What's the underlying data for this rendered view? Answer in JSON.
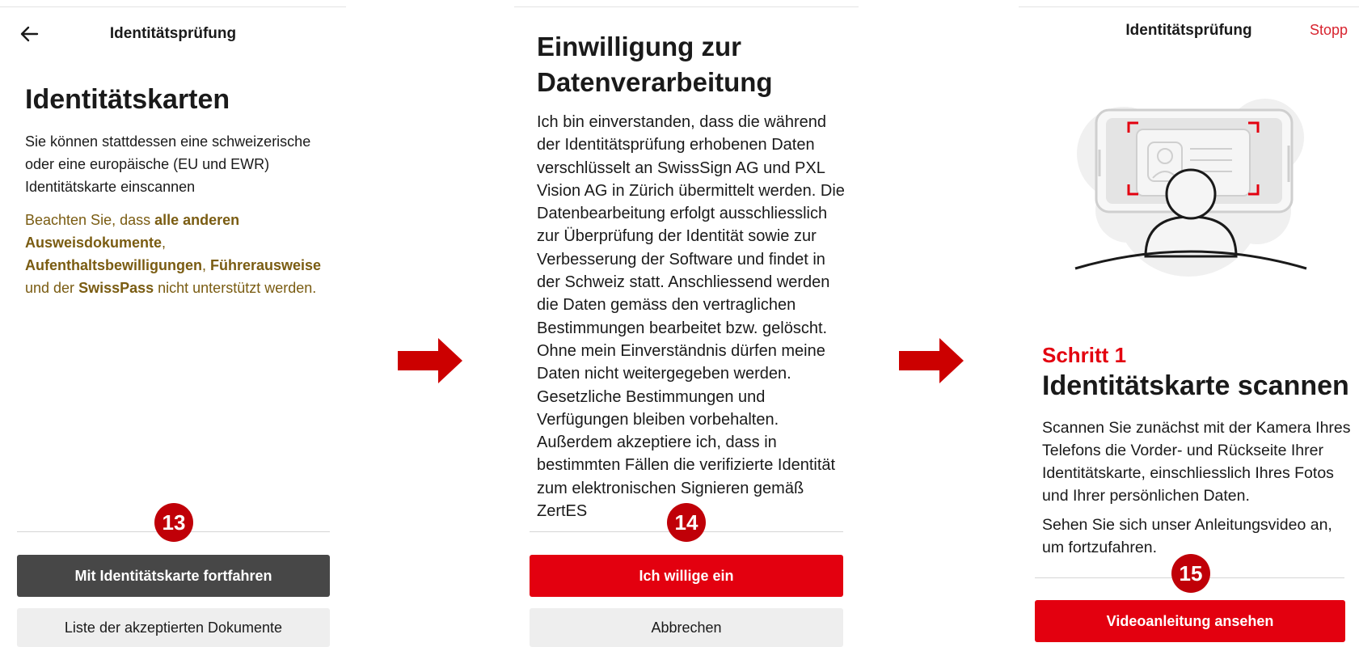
{
  "screen1": {
    "header_title": "Identitätsprüfung",
    "heading": "Identitätskarten",
    "description": "Sie können stattdessen eine schweizerische oder eine europäische (EU und EWR) Identitätskarte einscannen",
    "note": {
      "part1": "Beachten Sie, dass ",
      "bold1": "alle anderen Ausweisdokumente",
      "part2": ", ",
      "bold2": "Aufenthaltsbewilligungen",
      "part3": ", ",
      "bold3": "Führerausweise",
      "part4": " und der ",
      "bold4": "SwissPass",
      "part5": " nicht unterstützt werden."
    },
    "badge": "13",
    "primary_button": "Mit Identitätskarte fortfahren",
    "secondary_button": "Liste der akzeptierten Dokumente"
  },
  "screen2": {
    "heading_line1": "Einwilligung zur",
    "heading_line2": "Datenverarbeitung",
    "consent_text": "Ich bin einverstanden, dass die während der Identitätsprüfung erhobenen Daten verschlüsselt an SwissSign AG und PXL Vision AG in Zürich übermittelt werden. Die Datenbearbeitung erfolgt ausschliesslich zur Überprüfung der Identität sowie zur Verbesserung der Software und findet in der Schweiz statt. Anschliessend werden die Daten gemäss den vertraglichen Bestimmungen bearbeitet bzw. gelöscht. Ohne mein Einverständnis dürfen meine Daten nicht weitergegeben werden. Gesetzliche Bestimmungen und Verfügungen bleiben vorbehalten. Außerdem akzeptiere ich, dass in bestimmten Fällen die verifizierte Identität zum elektronischen Signieren gemäß ZertES",
    "badge": "14",
    "primary_button": "Ich willige ein",
    "secondary_button": "Abbrechen"
  },
  "screen3": {
    "header_title": "Identitätsprüfung",
    "stop_label": "Stopp",
    "step_label": "Schritt 1",
    "heading": "Identitätskarte scannen",
    "description1": "Scannen Sie zunächst mit der Kamera Ihres Telefons die Vorder- und Rückseite Ihrer Identitätskarte, einschliesslich Ihres Fotos und Ihrer persönlichen Daten.",
    "description2": "Sehen Sie sich unser Anleitungsvideo an, um fortzufahren.",
    "badge": "15",
    "primary_button": "Videoanleitung ansehen"
  },
  "colors": {
    "brand_red": "#e3000f",
    "badge_red": "#c00008",
    "note_brown": "#7a5c12",
    "dark_button": "#474747"
  },
  "icons": {
    "back": "back-arrow-icon",
    "flow_arrow": "right-arrow-icon",
    "illustration": "id-card-scan-illustration"
  }
}
